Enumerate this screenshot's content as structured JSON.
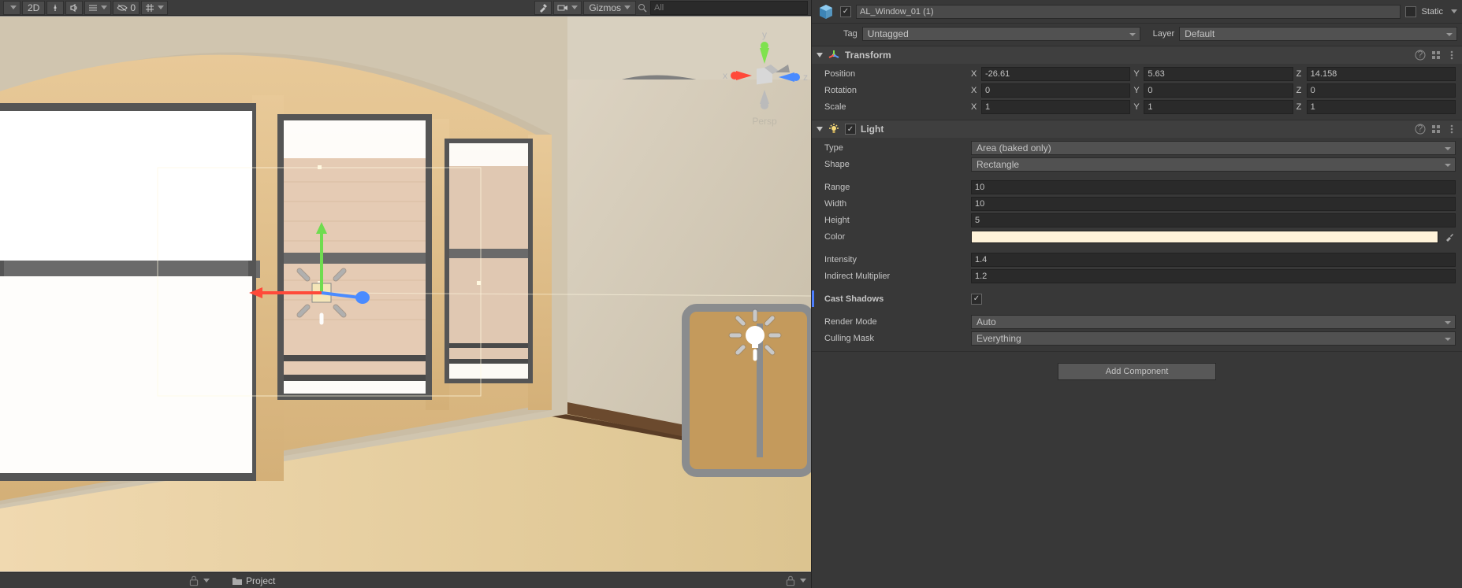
{
  "toolbar": {
    "mode_2d": "2D",
    "gizmos_label": "Gizmos",
    "visibility_count": "0",
    "search_placeholder": "All"
  },
  "inspector_header": {
    "object_name": "AL_Window_01 (1)",
    "static_label": "Static",
    "tag_label": "Tag",
    "tag_value": "Untagged",
    "layer_label": "Layer",
    "layer_value": "Default"
  },
  "transform": {
    "title": "Transform",
    "position_label": "Position",
    "position": {
      "x": "-26.61",
      "y": "5.63",
      "z": "14.158"
    },
    "rotation_label": "Rotation",
    "rotation": {
      "x": "0",
      "y": "0",
      "z": "0"
    },
    "scale_label": "Scale",
    "scale": {
      "x": "1",
      "y": "1",
      "z": "1"
    }
  },
  "light": {
    "title": "Light",
    "type_label": "Type",
    "type_value": "Area (baked only)",
    "shape_label": "Shape",
    "shape_value": "Rectangle",
    "range_label": "Range",
    "range_value": "10",
    "width_label": "Width",
    "width_value": "10",
    "height_label": "Height",
    "height_value": "5",
    "color_label": "Color",
    "color_value": "#fff3d9",
    "intensity_label": "Intensity",
    "intensity_value": "1.4",
    "indirect_label": "Indirect Multiplier",
    "indirect_value": "1.2",
    "shadows_label": "Cast Shadows",
    "render_mode_label": "Render Mode",
    "render_mode_value": "Auto",
    "culling_label": "Culling Mask",
    "culling_value": "Everything"
  },
  "add_component": "Add Component",
  "project_tab": "Project",
  "axis_labels": {
    "x": "x",
    "y": "y",
    "z": "z"
  },
  "persp_label": "Persp"
}
